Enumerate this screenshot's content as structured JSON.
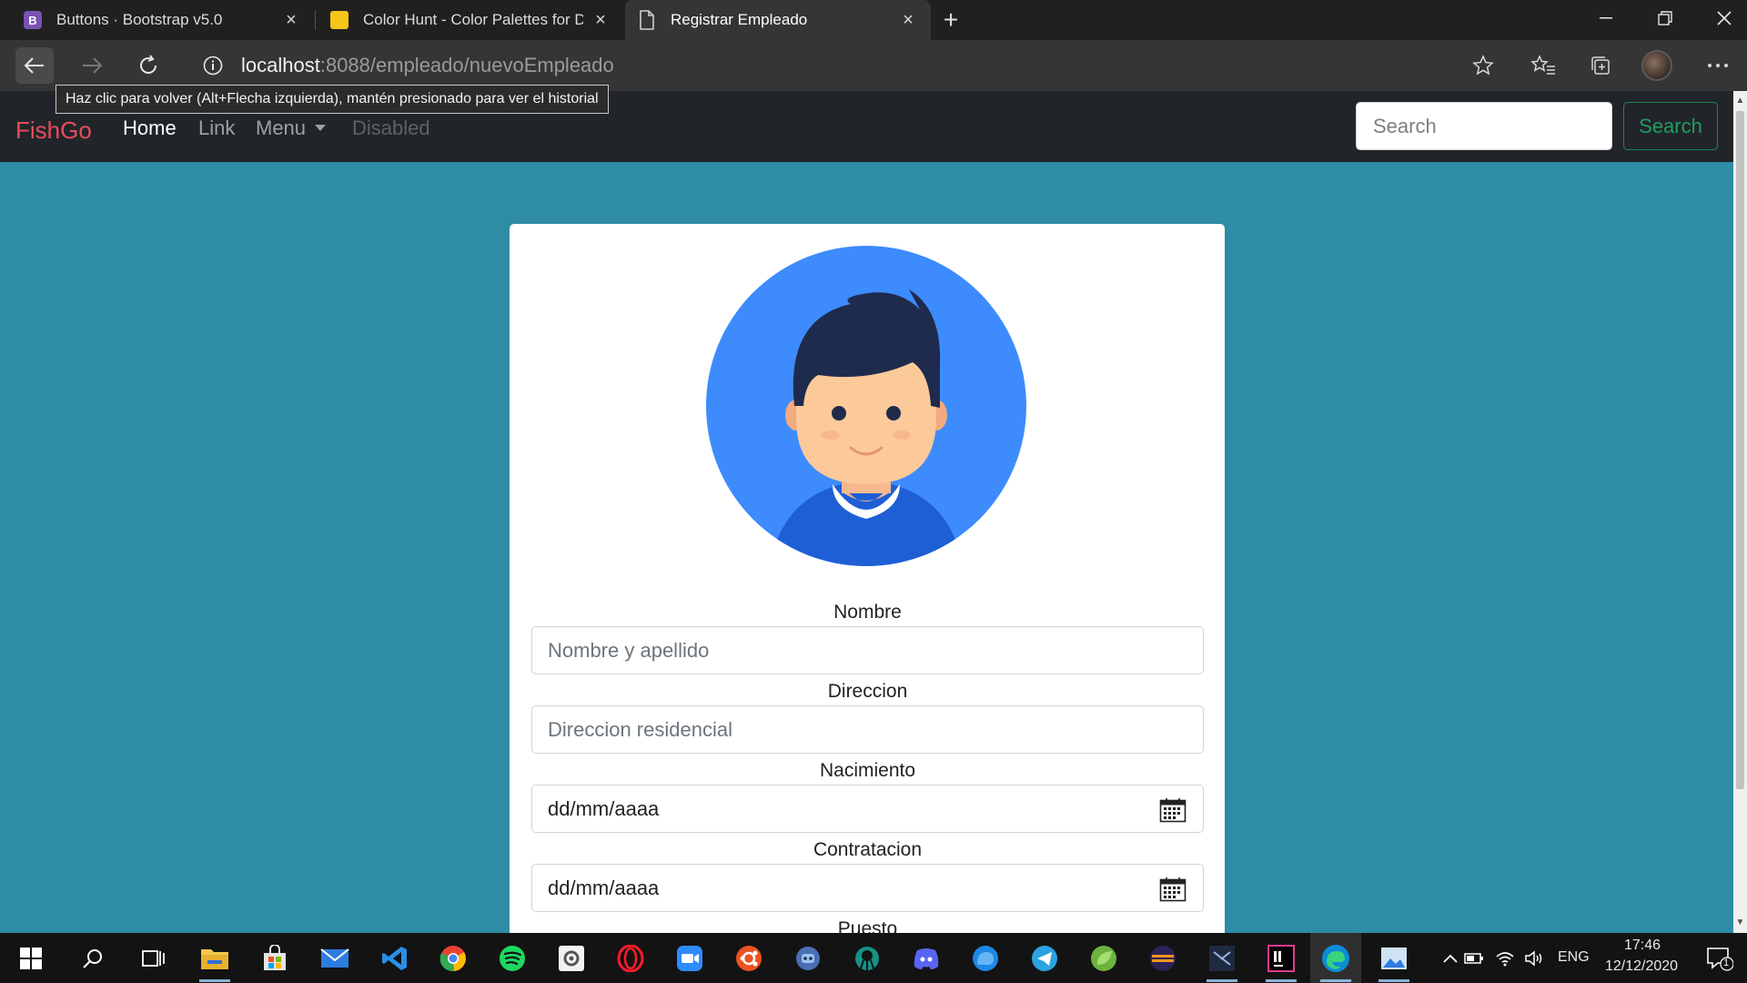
{
  "browser": {
    "tabs": [
      {
        "title": "Buttons · Bootstrap v5.0",
        "icon": "bootstrap-icon",
        "color": "#7952b3",
        "active": false
      },
      {
        "title": "Color Hunt - Color Palettes for Designers",
        "icon": "color-hunt-icon",
        "color": "#f5c518",
        "active": false
      },
      {
        "title": "Registrar Empleado",
        "icon": "page-icon",
        "color": "#cccccc",
        "active": true
      }
    ],
    "url_host": "localhost",
    "url_path": ":8088/empleado/nuevoEmpleado",
    "tooltip": "Haz clic para volver (Alt+Flecha izquierda), mantén presionado para ver el historial"
  },
  "navbar": {
    "brand": "FishGo",
    "links": {
      "home": "Home",
      "link": "Link",
      "menu": "Menu",
      "disabled": "Disabled"
    },
    "search_placeholder": "Search",
    "search_button": "Search"
  },
  "form": {
    "fields": {
      "nombre": {
        "label": "Nombre",
        "placeholder": "Nombre y apellido"
      },
      "direccion": {
        "label": "Direccion",
        "placeholder": "Direccion residencial"
      },
      "nacimiento": {
        "label": "Nacimiento",
        "value": "dd/mm/aaaa"
      },
      "contratacion": {
        "label": "Contratacion",
        "value": "dd/mm/aaaa"
      },
      "puesto": {
        "label": "Puesto"
      }
    }
  },
  "taskbar": {
    "apps": [
      "windows-start-icon",
      "search-icon",
      "task-view-icon",
      "file-explorer-icon",
      "store-icon",
      "mail-icon",
      "vscode-icon",
      "chrome-icon",
      "spotify-icon",
      "settings-app-icon",
      "opera-icon",
      "zoom-icon",
      "ubuntu-icon",
      "robot-app-icon",
      "gitkraken-icon",
      "discord-icon",
      "cloud-app-icon",
      "telegram-icon",
      "spring-icon",
      "eclipse-icon",
      "visual-studio-icon",
      "intellij-icon",
      "edge-icon",
      "photos-icon"
    ],
    "language": "ENG",
    "time": "17:46",
    "date": "12/12/2020",
    "notification_count": "1"
  },
  "colors": {
    "page_background": "#2e8ca4",
    "navbar_background": "#212529",
    "brand": "#e74c5e",
    "search_button": "#198754",
    "avatar_background": "#3d8bfd"
  }
}
